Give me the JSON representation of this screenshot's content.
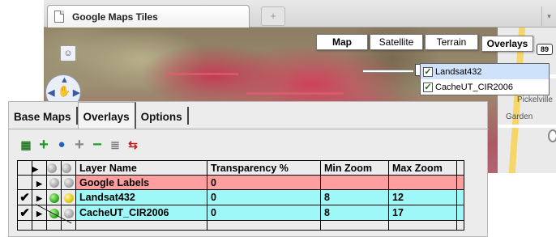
{
  "browser": {
    "tab_title": "Google Maps Tiles",
    "new_tab_label": "+",
    "tab_menu_label": "▾"
  },
  "map": {
    "map_types": [
      "Map",
      "Satellite",
      "Terrain"
    ],
    "selected_map_type": "Map",
    "overlays_button": "Overlays",
    "overlay_menu": [
      {
        "label": "Landsat432",
        "checked": true
      },
      {
        "label": "CacheUT_CIR2006",
        "checked": true
      }
    ],
    "places": {
      "pickleville": "Pickelville",
      "garden": "Garden"
    },
    "highway_shield": "89",
    "pegman_icon": "pegman-icon",
    "pan_icon": "pan-hand-icon"
  },
  "panel": {
    "tabs": [
      "Base Maps",
      "Overlays",
      "Options"
    ],
    "active_tab": "Overlays",
    "toolbar_icons": [
      "grid-icon",
      "add-icon",
      "globe-icon",
      "add-layer-icon",
      "remove-icon",
      "layer-stack-icon",
      "import-icon"
    ],
    "columns": [
      "Layer Name",
      "Transparency %",
      "Min Zoom",
      "Max Zoom"
    ],
    "rows": [
      {
        "name": "Google Labels",
        "transparency": "0",
        "min_zoom": "",
        "max_zoom": "",
        "checked": false,
        "color": "#ff9e9e"
      },
      {
        "name": "Landsat432",
        "transparency": "0",
        "min_zoom": "8",
        "max_zoom": "12",
        "checked": true,
        "color": "#9ef8f8"
      },
      {
        "name": "CacheUT_CIR2006",
        "transparency": "0",
        "min_zoom": "8",
        "max_zoom": "17",
        "checked": true,
        "color": "#9ef8f8"
      }
    ],
    "checkmark": "✔"
  }
}
